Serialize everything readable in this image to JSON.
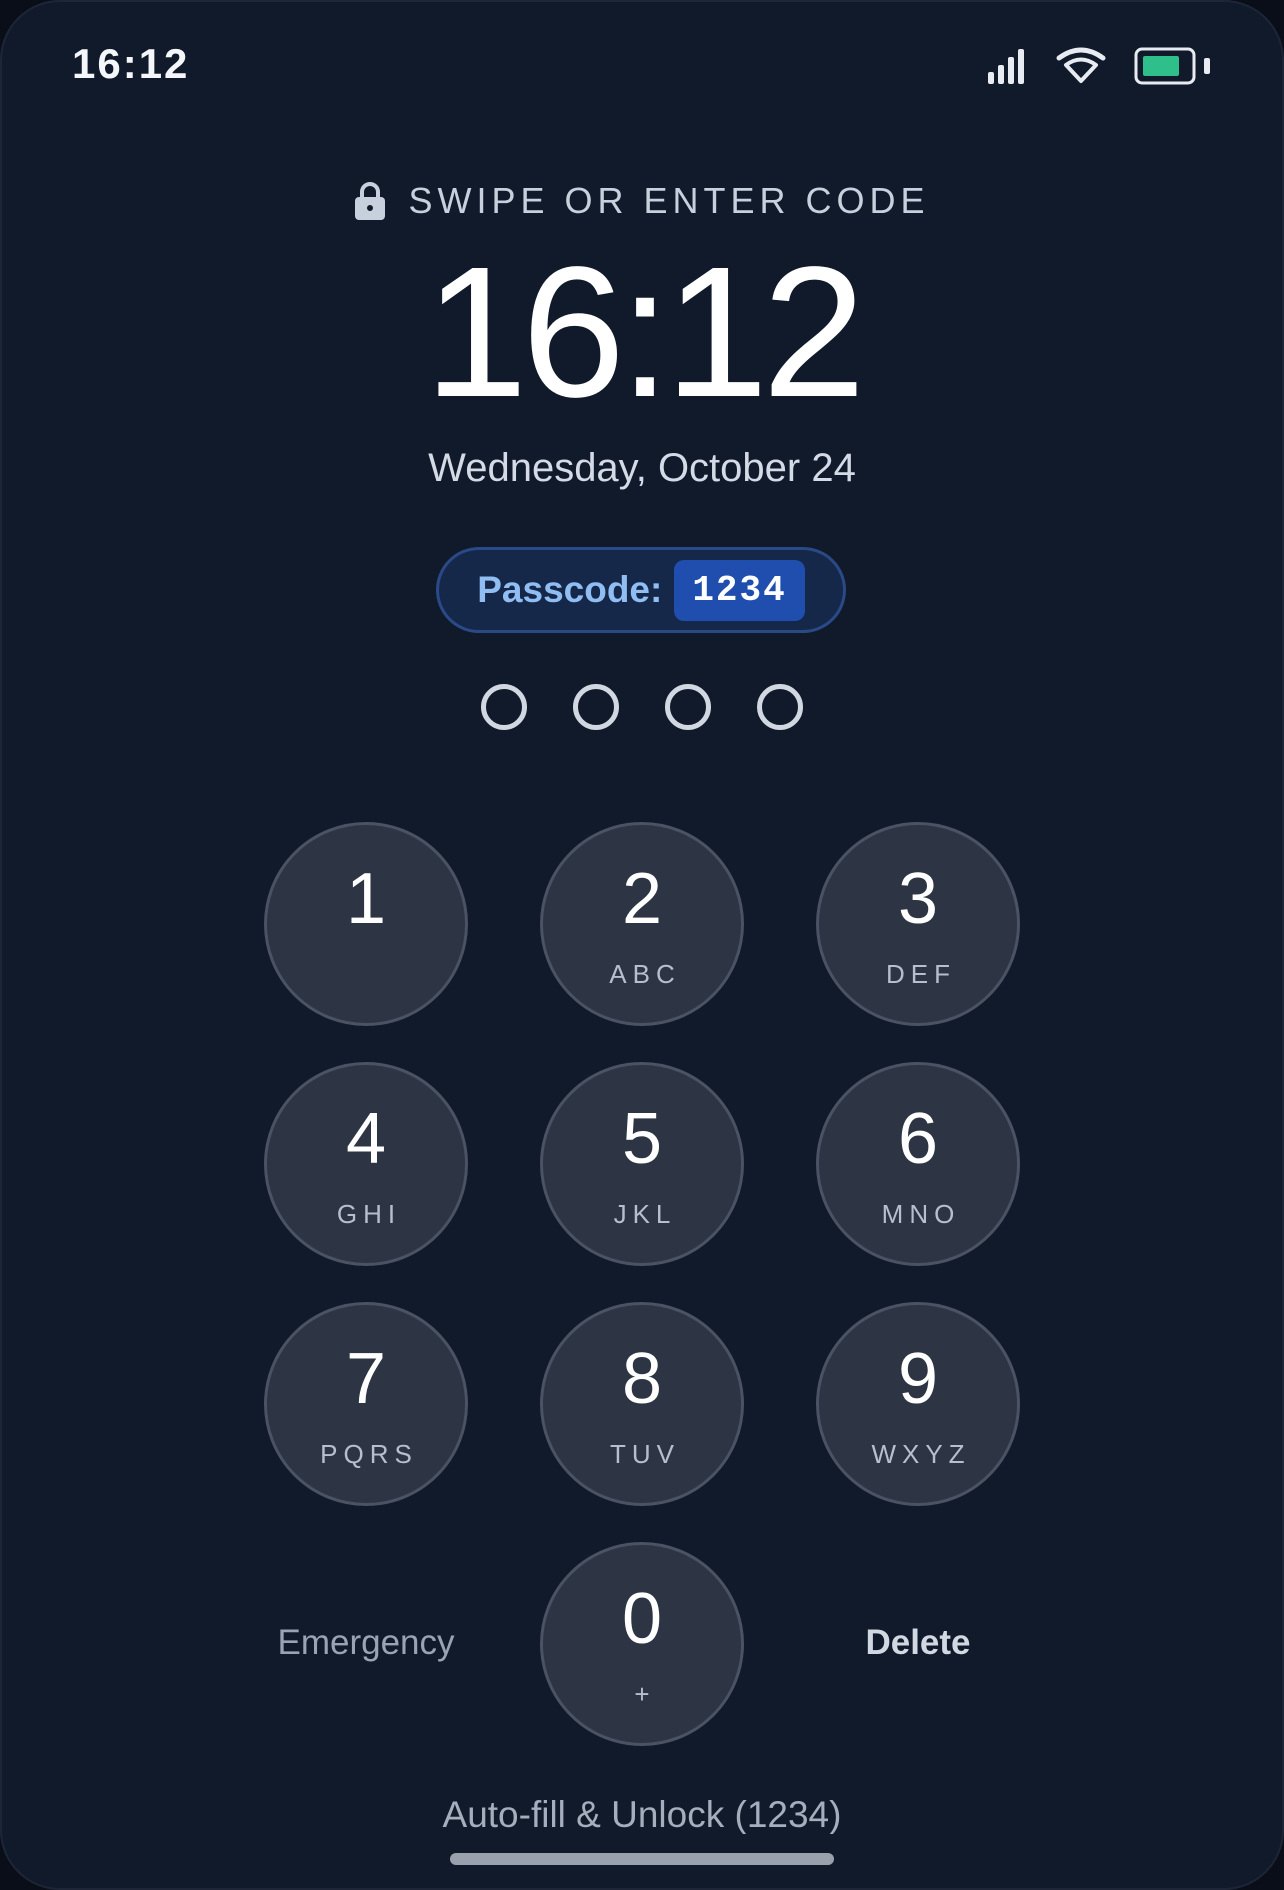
{
  "status_bar": {
    "time": "16:12",
    "icons": [
      "signal-icon",
      "wifi-icon",
      "battery-icon"
    ],
    "battery_color": "#2fbf8a"
  },
  "lock_screen": {
    "prompt": "SWIPE OR ENTER CODE",
    "time": "16:12",
    "date": "Wednesday, October 24",
    "passcode_label": "Passcode:",
    "passcode_value": "1234",
    "entered_digits": 0,
    "total_digits": 4
  },
  "keypad": {
    "keys": [
      {
        "digit": "1",
        "letters": ""
      },
      {
        "digit": "2",
        "letters": "ABC"
      },
      {
        "digit": "3",
        "letters": "DEF"
      },
      {
        "digit": "4",
        "letters": "GHI"
      },
      {
        "digit": "5",
        "letters": "JKL"
      },
      {
        "digit": "6",
        "letters": "MNO"
      },
      {
        "digit": "7",
        "letters": "PQRS"
      },
      {
        "digit": "8",
        "letters": "TUV"
      },
      {
        "digit": "9",
        "letters": "WXYZ"
      },
      {
        "digit": "0",
        "letters": "+"
      }
    ],
    "emergency_label": "Emergency",
    "delete_label": "Delete"
  },
  "footer": {
    "autofill_label": "Auto-fill & Unlock (1234)"
  },
  "colors": {
    "background": "#111a2b",
    "key_fill": "#2d3444",
    "passcode_accent": "#1f4eaf"
  }
}
